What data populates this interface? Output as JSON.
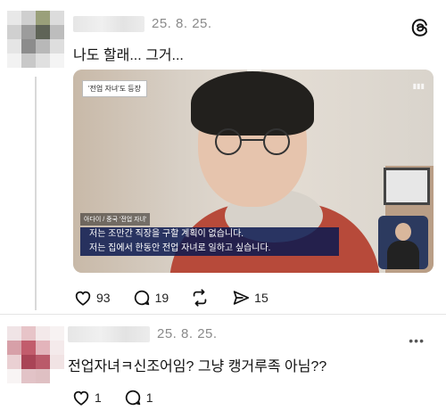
{
  "posts": [
    {
      "date": "25. 8. 25.",
      "text": "나도 할래... 그거...",
      "media": {
        "news_tag": "'전업 자녀'도 등장",
        "speaker": "아다이 / 중국 '전업 자녀'",
        "caption_line1": "저는 조만간 직장을 구할 계획이 없습니다.",
        "caption_line2": "저는 집에서 한동안 전업 자녀로 일하고 싶습니다."
      },
      "actions": {
        "likes": "93",
        "replies": "19",
        "quotes": "15"
      }
    },
    {
      "date": "25. 8. 25.",
      "text": "전업자녀ㅋ신조어임? 그냥 캥거루족 아님??",
      "actions": {
        "likes": "1",
        "replies": "1"
      }
    }
  ],
  "colors": {
    "caption_bg": "#0a1950",
    "subtle_text": "#8a8a8a"
  }
}
